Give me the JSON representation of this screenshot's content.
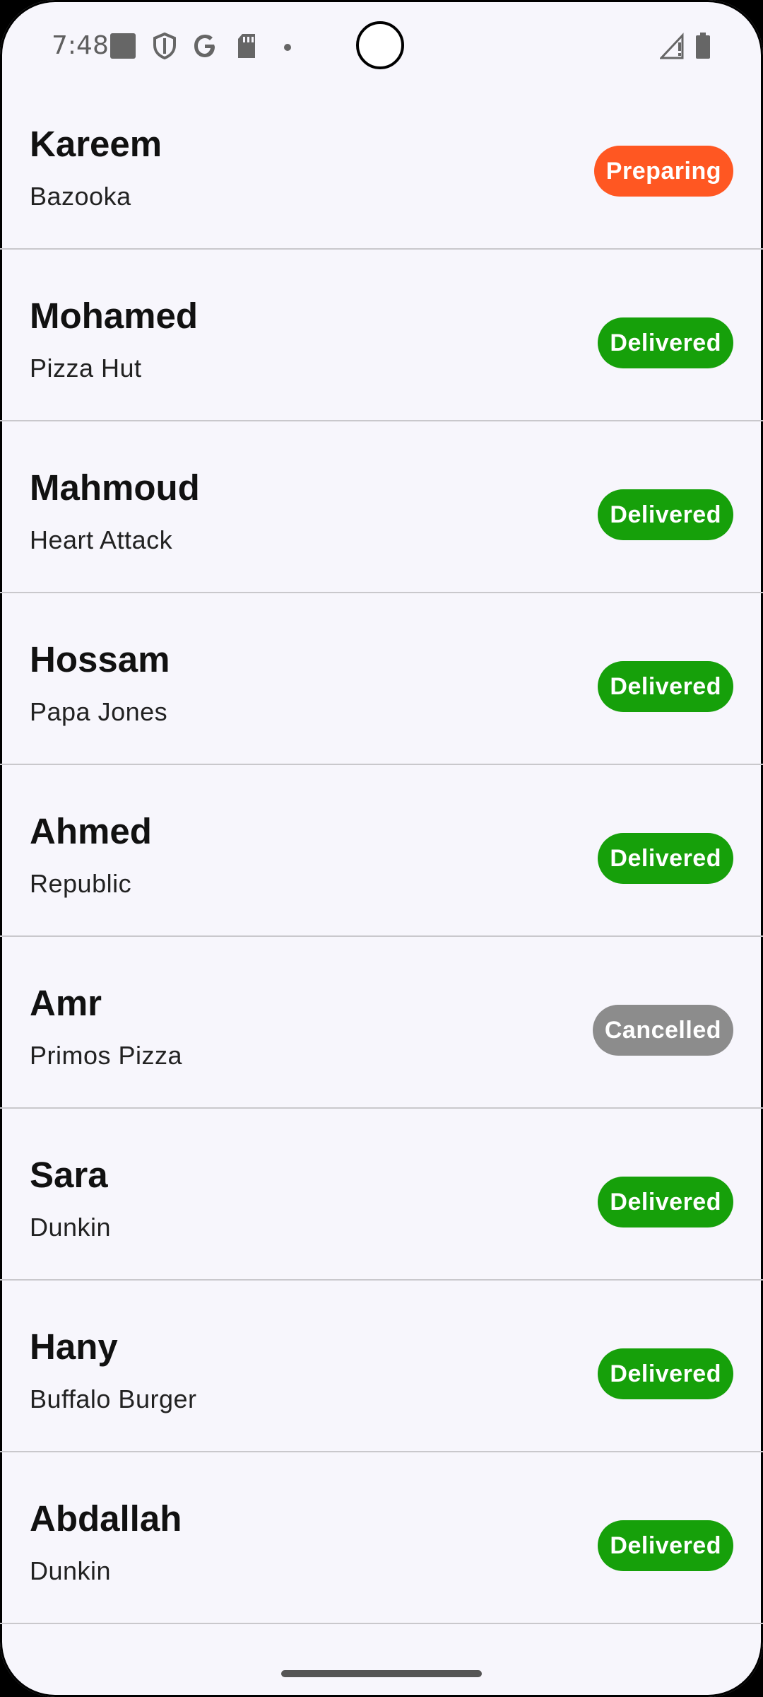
{
  "status_bar": {
    "time": "7:48",
    "icons": [
      "notification-square-icon",
      "shield-icon",
      "google-icon",
      "sd-card-icon",
      "dot-icon",
      "signal-icon",
      "battery-icon"
    ]
  },
  "colors": {
    "Preparing": "#ff5722",
    "Delivered": "#16a00a",
    "Cancelled": "#8c8c8c"
  },
  "orders": [
    {
      "customer": "Kareem",
      "restaurant": "Bazooka",
      "status": "Preparing"
    },
    {
      "customer": "Mohamed",
      "restaurant": "Pizza Hut",
      "status": "Delivered"
    },
    {
      "customer": "Mahmoud",
      "restaurant": "Heart Attack",
      "status": "Delivered"
    },
    {
      "customer": "Hossam",
      "restaurant": "Papa Jones",
      "status": "Delivered"
    },
    {
      "customer": "Ahmed",
      "restaurant": "Republic",
      "status": "Delivered"
    },
    {
      "customer": "Amr",
      "restaurant": "Primos Pizza",
      "status": "Cancelled"
    },
    {
      "customer": "Sara",
      "restaurant": "Dunkin",
      "status": "Delivered"
    },
    {
      "customer": "Hany",
      "restaurant": "Buffalo Burger",
      "status": "Delivered"
    },
    {
      "customer": "Abdallah",
      "restaurant": "Dunkin",
      "status": "Delivered"
    }
  ]
}
